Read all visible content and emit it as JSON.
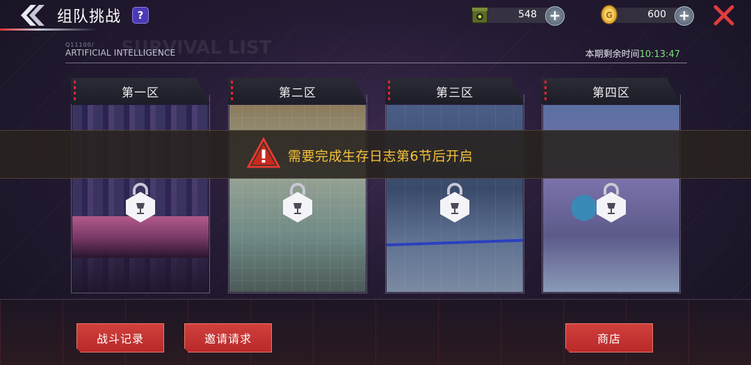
{
  "header": {
    "title": "组队挑战",
    "help_label": "?"
  },
  "resources": {
    "ammo": {
      "value": "548",
      "icon": "ammo-box-icon"
    },
    "gold": {
      "value": "600",
      "icon": "gold-coin-icon"
    }
  },
  "info": {
    "code": "Q11100/",
    "subtitle": "ARTIFICIAL INTELLIGENCE",
    "ghost_text": "SURVIVAL LIST",
    "timer_label": "本期剩余时间",
    "timer_value": "10:13:47"
  },
  "zones": [
    {
      "label": "第一区"
    },
    {
      "label": "第二区"
    },
    {
      "label": "第三区"
    },
    {
      "label": "第四区"
    }
  ],
  "banner": {
    "message": "需要完成生存日志第6节后开启"
  },
  "buttons": {
    "battle_record": "战斗记录",
    "invite_request": "邀请请求",
    "shop": "商店"
  },
  "colors": {
    "accent_red": "#c8342f",
    "warning_yellow": "#f5c23a",
    "timer_green": "#7ee07e"
  }
}
